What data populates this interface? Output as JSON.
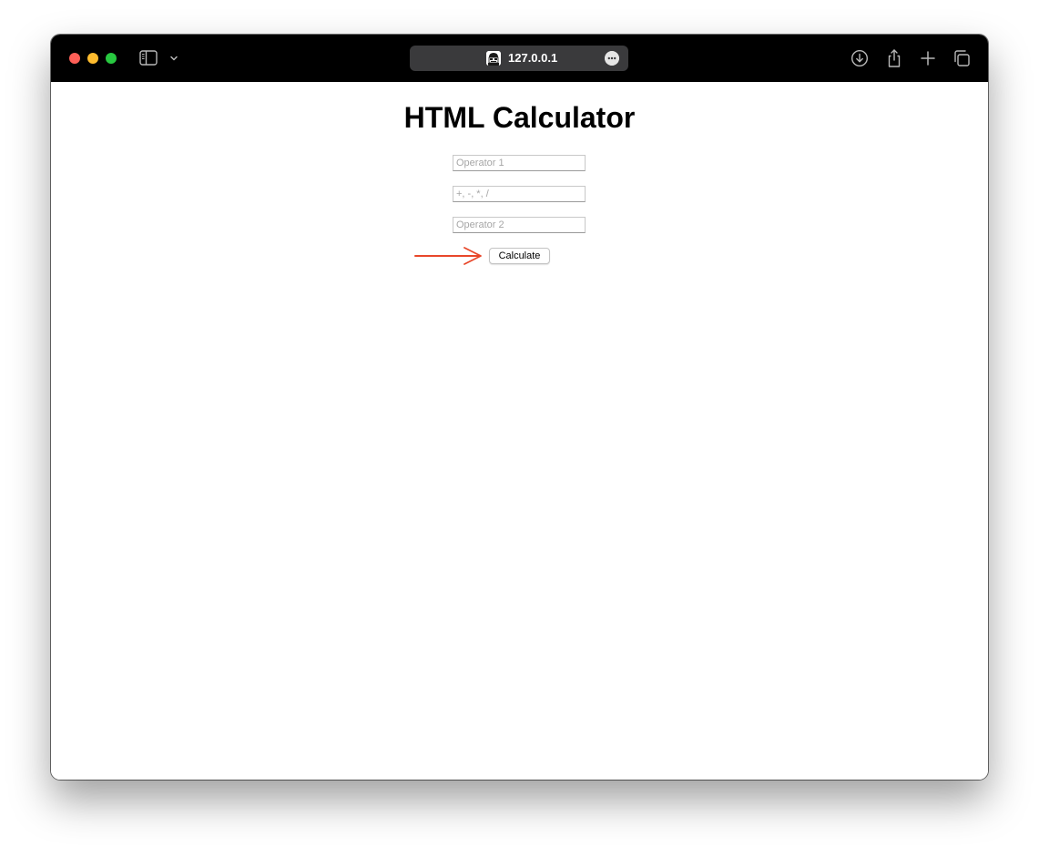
{
  "browser": {
    "url": "127.0.0.1",
    "icons": [
      "sidebar-icon",
      "chevron-down-icon",
      "favicon-icon",
      "more-icon",
      "download-icon",
      "share-icon",
      "plus-icon",
      "tabs-icon"
    ],
    "traffic_colors": {
      "close": "#fe5f57",
      "minimize": "#febc2e",
      "maximize": "#28c840"
    }
  },
  "page": {
    "title": "HTML Calculator",
    "operand1": {
      "placeholder": "Operator 1",
      "value": ""
    },
    "operator": {
      "placeholder": "+, -, *, /",
      "value": ""
    },
    "operand2": {
      "placeholder": "Operator 2",
      "value": ""
    },
    "calculate_label": "Calculate"
  },
  "annotation": {
    "color": "#e8472a",
    "target": "calculate-button"
  }
}
